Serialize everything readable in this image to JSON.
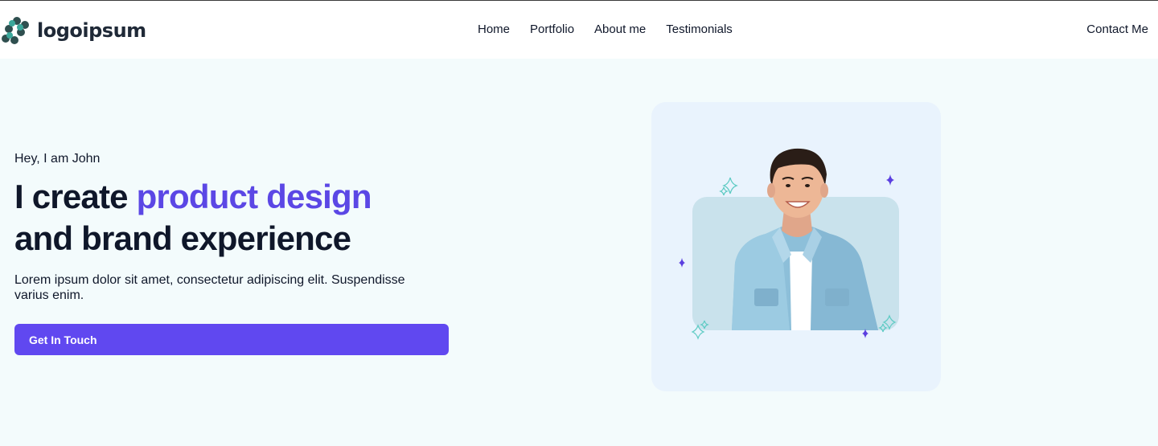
{
  "brand": {
    "name": "logoipsum"
  },
  "nav": {
    "items": [
      {
        "label": "Home"
      },
      {
        "label": "Portfolio"
      },
      {
        "label": "About me"
      },
      {
        "label": "Testimonials"
      }
    ],
    "contact_label": "Contact Me"
  },
  "hero": {
    "greeting": "Hey, I am John",
    "headline_start": "I create ",
    "headline_accent": "product design",
    "headline_end": "and brand experience",
    "description": "Lorem ipsum dolor sit amet, consectetur adipiscing elit. Suspendisse varius enim.",
    "cta_label": "Get In Touch"
  },
  "colors": {
    "accent": "#6048f0",
    "headline_accent": "#5b47e5",
    "hero_background": "#f3fbfc",
    "card_background": "#e9f3fd",
    "photo_backdrop": "#c9e2ec",
    "sparkle_teal": "#5fcbc4",
    "sparkle_purple": "#5b3fe0"
  },
  "icons": {
    "logo": "logo-mark-icon",
    "sparkles": "sparkle-icon"
  }
}
